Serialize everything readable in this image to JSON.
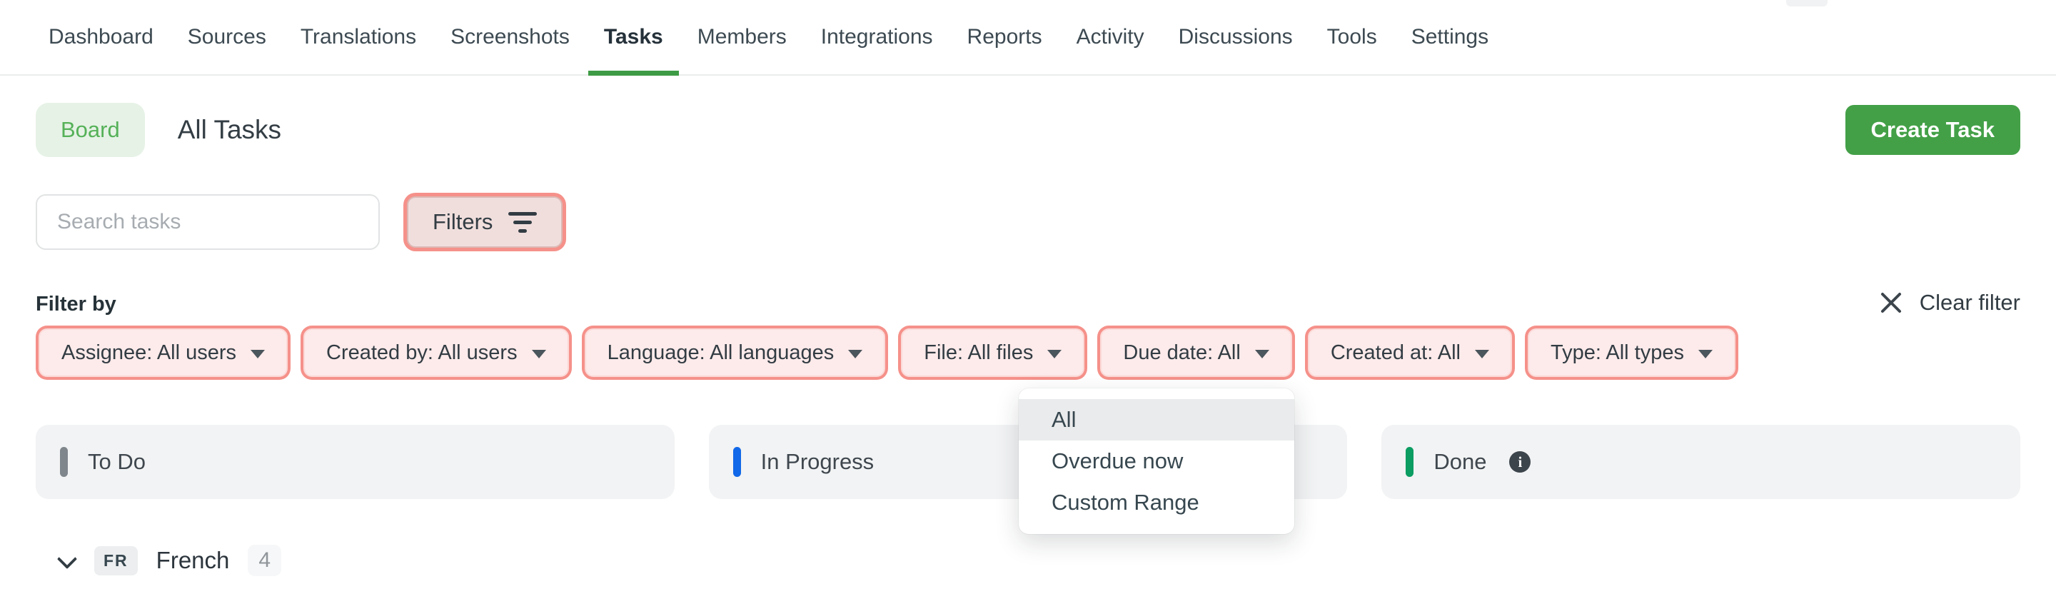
{
  "nav": {
    "items": [
      {
        "label": "Dashboard",
        "active": false
      },
      {
        "label": "Sources",
        "active": false
      },
      {
        "label": "Translations",
        "active": false
      },
      {
        "label": "Screenshots",
        "active": false
      },
      {
        "label": "Tasks",
        "active": true
      },
      {
        "label": "Members",
        "active": false
      },
      {
        "label": "Integrations",
        "active": false
      },
      {
        "label": "Reports",
        "active": false
      },
      {
        "label": "Activity",
        "active": false
      },
      {
        "label": "Discussions",
        "active": false
      },
      {
        "label": "Tools",
        "active": false
      },
      {
        "label": "Settings",
        "active": false
      }
    ]
  },
  "toolbar": {
    "view_toggle_label": "Board",
    "title": "All Tasks",
    "create_button_label": "Create Task"
  },
  "search": {
    "placeholder": "Search tasks",
    "value": "",
    "filters_button_label": "Filters"
  },
  "filter_bar": {
    "section_label": "Filter by",
    "clear_button_label": "Clear filter",
    "chips": [
      {
        "label": "Assignee: All users"
      },
      {
        "label": "Created by: All users"
      },
      {
        "label": "Language: All languages"
      },
      {
        "label": "File: All files"
      },
      {
        "label": "Due date: All"
      },
      {
        "label": "Created at: All"
      },
      {
        "label": "Type: All types"
      }
    ]
  },
  "due_date_menu": {
    "items": [
      {
        "label": "All",
        "selected": true
      },
      {
        "label": "Overdue now",
        "selected": false
      },
      {
        "label": "Custom Range",
        "selected": false
      }
    ]
  },
  "board": {
    "columns": [
      {
        "title": "To Do",
        "color": "#7f868c",
        "has_info": false
      },
      {
        "title": "In Progress",
        "color": "#1168e8",
        "has_info": false
      },
      {
        "title": "Done",
        "color": "#0b9d62",
        "has_info": true
      }
    ]
  },
  "language_group": {
    "code": "FR",
    "name": "French",
    "count": "4"
  },
  "colors": {
    "accent_green": "#43a047",
    "active_tab_underline": "#3e9b45",
    "highlight_ring": "#f5918a",
    "chip_background": "#fdeaea",
    "column_background": "#f2f3f4"
  }
}
